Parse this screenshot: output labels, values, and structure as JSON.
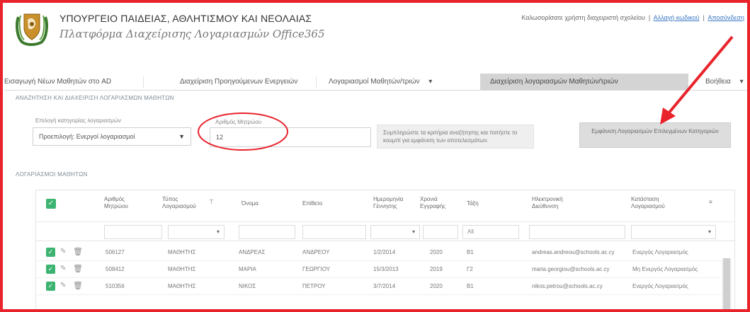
{
  "header": {
    "ministry": "ΥΠΟΥΡΓΕΙΟ ΠΑΙΔΕΙΑΣ, ΑΘΛΗΤΙΣΜΟΥ ΚΑΙ ΝΕΟΛΑΙΑΣ",
    "platform": "Πλατφόρμα Διαχείρισης Λογαριασμών Office365",
    "user_text": "Καλωσορίσατε χρήστη διαχειριστή σχολείου",
    "user_link": "Αλλαγή κωδικού",
    "logout_link": "Αποσύνδεση"
  },
  "nav": {
    "items": [
      {
        "label": "Εισαγωγή Νέων Μαθητών στο AD"
      },
      {
        "label": "Διαχείριση Προηγούμενων Ενεργειών"
      },
      {
        "label": "Λογαριασμοί Μαθητών/τριών",
        "caret": "▾"
      },
      {
        "label": "Διαχείριση λογαριασμών Μαθητών/τριών"
      },
      {
        "label": "Βοήθεια",
        "caret": "▾"
      }
    ]
  },
  "filters": {
    "section_title": "ΑΝΑΖΗΤΗΣΗ ΚΑΙ ΔΙΑΧΕΙΡΙΣΗ ΛΟΓΑΡΙΑΣΜΩΝ ΜΑΘΗΤΩΝ",
    "select_label": "Επιλογή κατηγορίας λογαριασμών",
    "select_value": "Προεπιλογή: Ενεργοί λογαριασμοί",
    "input_label": "Αριθμός Μητρώου",
    "input_value": "12",
    "info_text": "Συμπληρώστε τα κριτήρια αναζήτησης και πατήστε το κουμπί για εμφάνιση των αποτελεσμάτων.",
    "button_label": "Εμφάνιση Λογαριασμών Επιλεγμένων Κατηγοριών"
  },
  "results": {
    "section_title": "ΛΟΓΑΡΙΑΣΜΟΙ ΜΑΘΗΤΩΝ",
    "columns": [
      "Αριθμός Μητρώου",
      "Τύπος Λογαριασμού",
      "Όνομα",
      "Επίθετο",
      "Ημερομηνία Γέννησης",
      "Χρονιά Εγγραφής",
      "Τάξη",
      "Ηλεκτρονική Διεύθυνση",
      "Κατάσταση Λογαριασμού"
    ],
    "filter_all": "All",
    "rows": [
      [
        "506127",
        "ΜΑΘΗΤΗΣ",
        "ΑΝΔΡΕΑΣ",
        "ΑΝΔΡΕΟΥ",
        "1/2/2014",
        "2020",
        "Β1",
        "andreas.andreou@schools.ac.cy",
        "Ενεργός Λογαριασμός"
      ],
      [
        "508412",
        "ΜΑΘΗΤΗΣ",
        "ΜΑΡΙΑ",
        "ΓΕΩΡΓΙΟΥ",
        "15/3/2013",
        "2019",
        "Γ2",
        "maria.georgiou@schools.ac.cy",
        "Μη Ενεργός Λογαριασμός"
      ],
      [
        "510356",
        "ΜΑΘΗΤΗΣ",
        "ΝΙΚΟΣ",
        "ΠΕΤΡΟΥ",
        "3/7/2014",
        "2020",
        "Β1",
        "nikos.petrou@schools.ac.cy",
        "Ενεργός Λογαριασμός"
      ]
    ]
  },
  "colors": {
    "frame": "#e8232b",
    "check": "#3cb371",
    "annotation": "#e8232b"
  },
  "icons": [
    "crest-icon",
    "edit-icon",
    "trash-icon",
    "chevron-down-icon",
    "check-icon"
  ]
}
